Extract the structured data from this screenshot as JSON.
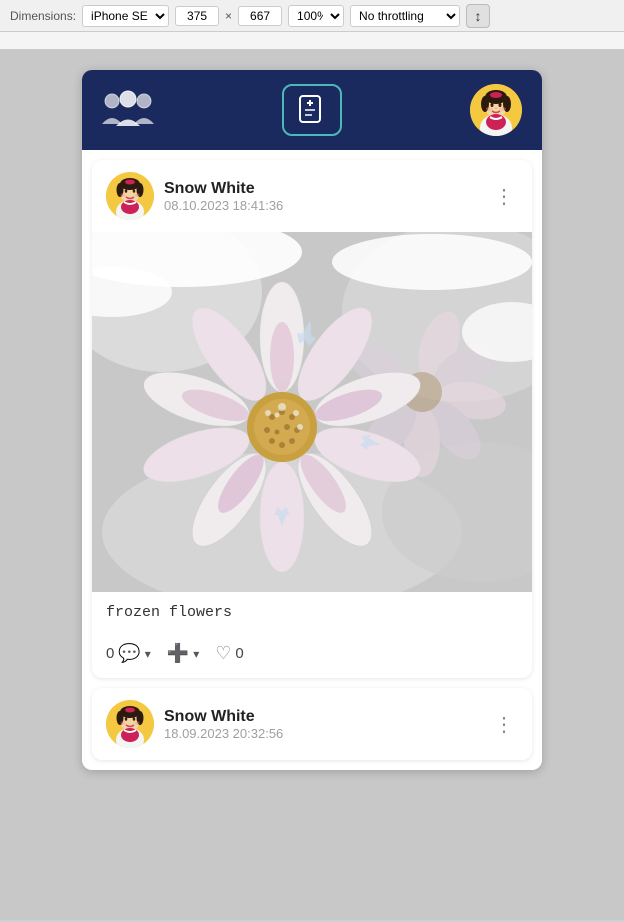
{
  "browser_bar": {
    "dim_label": "Dimensions:",
    "device_name": "iPhone SE",
    "width": "375",
    "height": "667",
    "zoom": "100%",
    "throttle": "No throttling"
  },
  "navbar": {
    "add_button_label": "+",
    "groups_icon_name": "groups-icon"
  },
  "post1": {
    "username": "Snow White",
    "timestamp": "08.10.2023 18:41:36",
    "caption": "frozen flowers",
    "comment_count": "0",
    "like_count": "0",
    "menu_icon": "⋮"
  },
  "post2": {
    "username": "Snow White",
    "timestamp": "18.09.2023 20:32:56",
    "menu_icon": "⋮"
  },
  "actions": {
    "comment_label": "0",
    "add_label": "",
    "like_label": "0"
  }
}
